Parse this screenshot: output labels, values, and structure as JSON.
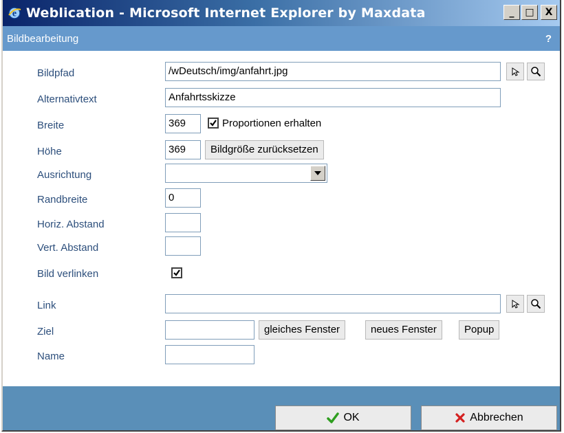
{
  "window": {
    "title": "Weblication - Microsoft Internet Explorer by Maxdata",
    "controls": {
      "minimize": "_",
      "maximize": "□",
      "close": "X"
    }
  },
  "dialog": {
    "title": "Bildbearbeitung",
    "help": "?"
  },
  "form": {
    "bildpfad": {
      "label": "Bildpfad",
      "value": "/wDeutsch/img/anfahrt.jpg"
    },
    "alternativtext": {
      "label": "Alternativtext",
      "value": "Anfahrtsskizze"
    },
    "breite": {
      "label": "Breite",
      "value": "369",
      "keep_proportions_label": "Proportionen erhalten",
      "keep_proportions_checked": true
    },
    "hoehe": {
      "label": "Höhe",
      "value": "369",
      "reset_button": "Bildgröße zurücksetzen"
    },
    "ausrichtung": {
      "label": "Ausrichtung",
      "value": ""
    },
    "randbreite": {
      "label": "Randbreite",
      "value": "0"
    },
    "horiz_abstand": {
      "label": "Horiz. Abstand",
      "value": ""
    },
    "vert_abstand": {
      "label": "Vert. Abstand",
      "value": ""
    },
    "bild_verlinken": {
      "label": "Bild verlinken",
      "checked": true
    },
    "link": {
      "label": "Link",
      "value": ""
    },
    "ziel": {
      "label": "Ziel",
      "value": "",
      "buttons": {
        "same_window": "gleiches Fenster",
        "new_window": "neues Fenster",
        "popup": "Popup"
      }
    },
    "name": {
      "label": "Name",
      "value": ""
    }
  },
  "footer": {
    "ok": "OK",
    "cancel": "Abbrechen"
  },
  "colors": {
    "label": "#2d4f7c",
    "ok_check": "#2e9e1f",
    "cancel_x": "#d42020",
    "subheader": "#6699cc"
  },
  "icons": {
    "browse": "cursor-arrow-icon",
    "preview": "magnifier-icon",
    "app": "internet-explorer-icon"
  }
}
